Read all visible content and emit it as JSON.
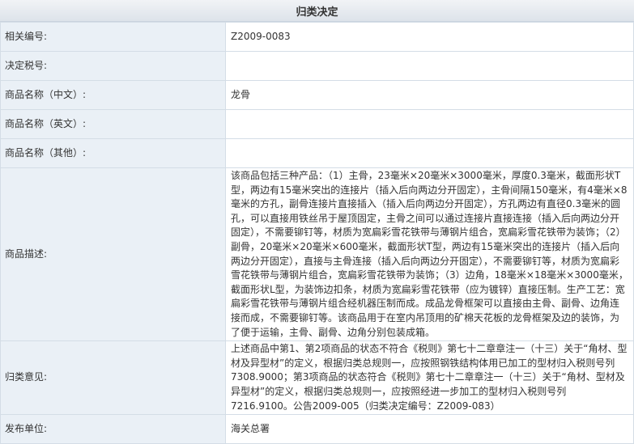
{
  "header": {
    "title": "归类决定"
  },
  "rows": [
    {
      "label": "相关编号:",
      "value": "Z2009-0083"
    },
    {
      "label": "决定税号:",
      "value": ""
    },
    {
      "label": "商品名称（中文）:",
      "value": "龙骨"
    },
    {
      "label": "商品名称（英文）:",
      "value": ""
    },
    {
      "label": "商品名称（其他）:",
      "value": ""
    },
    {
      "label": "商品描述:",
      "value": "该商品包括三种产品：（1）主骨，23毫米×20毫米×3000毫米，厚度0.3毫米，截面形状T型，两边有15毫米突出的连接片（插入后向两边分开固定），主骨间隔150毫米，有4毫米×8毫米的方孔，副骨连接片直接插入（插入后向两边分开固定），方孔两边有直径0.3毫米的圆孔，可以直接用铁丝吊于屋顶固定，主骨之间可以通过连接片直接连接（插入后向两边分开固定），不需要铆钉等，材质为宽扁彩雪花铁带与薄钢片组合，宽扁彩雪花铁带为装饰；（2）副骨，20毫米×20毫米×600毫米，截面形状T型，两边有15毫米突出的连接片（插入后向两边分开固定），直接与主骨连接（插入后向两边分开固定），不需要铆钉等，材质为宽扁彩雪花铁带与薄钢片组合，宽扁彩雪花铁带为装饰；（3）边角，18毫米×18毫米×3000毫米，截面形状L型，为装饰边扣条，材质为宽扁彩雪花铁带（应为镀锌）直接压制。生产工艺：宽扁彩雪花铁带与薄钢片组合经机器压制而成。成品龙骨框架可以直接由主骨、副骨、边角连接而成，不需要铆钉等。该商品用于在室内吊顶用的矿棉天花板的龙骨框架及边的装饰，为了便于运输，主骨、副骨、边角分别包装成箱。"
    },
    {
      "label": "归类意见:",
      "value": "上述商品中第1、第2项商品的状态不符合《税则》第七十二章章注一（十三）关于“角材、型材及异型材”的定义，根据归类总规则一，应按照钢铁结构体用已加工的型材归入税则号列7308.9000；第3项商品的状态符合《税则》第七十二章章注一（十三）关于“角材、型材及异型材”的定义，根据归类总规则一，应按照经进一步加工的型材归入税则号列7216.9100。公告2009-005（归类决定编号：Z2009-083）"
    },
    {
      "label": "发布单位:",
      "value": "海关总署"
    }
  ]
}
